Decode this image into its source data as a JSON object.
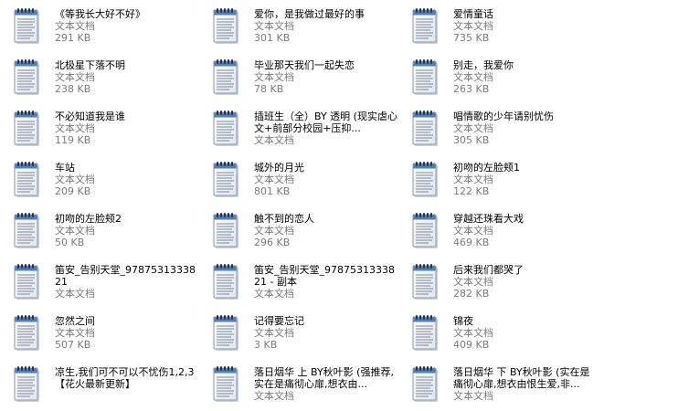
{
  "files": [
    {
      "name": "《等我长大好不好》",
      "type": "文本文档",
      "size": "291 KB"
    },
    {
      "name": "爱你，是我做过最好的事",
      "type": "文本文档",
      "size": "301 KB"
    },
    {
      "name": "爱情童话",
      "type": "文本文档",
      "size": "735 KB"
    },
    {
      "name": "北极星下落不明",
      "type": "文本文档",
      "size": "238 KB"
    },
    {
      "name": "毕业那天我们一起失恋",
      "type": "文本文档",
      "size": "78 KB"
    },
    {
      "name": "别走，我爱你",
      "type": "文本文档",
      "size": "263 KB"
    },
    {
      "name": "不必知道我是谁",
      "type": "文本文档",
      "size": "119 KB"
    },
    {
      "name": "插班生（全）BY 透明 (现实虐心文+前部分校园+压抑...",
      "type": "文本文档",
      "size": ""
    },
    {
      "name": "唱情歌的少年请别忧伤",
      "type": "文本文档",
      "size": "305 KB"
    },
    {
      "name": "车站",
      "type": "文本文档",
      "size": "209 KB"
    },
    {
      "name": "城外的月光",
      "type": "文本文档",
      "size": "801 KB"
    },
    {
      "name": "初吻的左脸颊1",
      "type": "文本文档",
      "size": "122 KB"
    },
    {
      "name": "初吻的左脸颊2",
      "type": "文本文档",
      "size": "50 KB"
    },
    {
      "name": "触不到的恋人",
      "type": "文本文档",
      "size": "296 KB"
    },
    {
      "name": "穿越还珠看大戏",
      "type": "文本文档",
      "size": "469 KB"
    },
    {
      "name": "笛安_告别天堂_9787531333821",
      "type": "文本文档",
      "size": ""
    },
    {
      "name": "笛安_告别天堂_9787531333821 - 副本",
      "type": "文本文档",
      "size": ""
    },
    {
      "name": "后来我们都哭了",
      "type": "文本文档",
      "size": "282 KB"
    },
    {
      "name": "忽然之间",
      "type": "文本文档",
      "size": "507 KB"
    },
    {
      "name": "记得要忘记",
      "type": "文本文档",
      "size": "3 KB"
    },
    {
      "name": "锦夜",
      "type": "文本文档",
      "size": "409 KB"
    },
    {
      "name": "凉生,我们可不可以不忧伤1,2,3【花火最新更新】",
      "type": "",
      "size": ""
    },
    {
      "name": "落日烟华 上 BY秋叶影 (强推荐,实在是痛彻心扉,想衣由...",
      "type": "文本文档",
      "size": ""
    },
    {
      "name": "落日烟华 下 BY秋叶影 (实在是痛彻心扉,想衣由恨生爱,非...",
      "type": "文本文档",
      "size": ""
    }
  ],
  "icon": "notepad-text-document-icon",
  "colors": {
    "meta_text": "#7b7b7b",
    "name_text": "#000000",
    "background": "#ffffff"
  }
}
